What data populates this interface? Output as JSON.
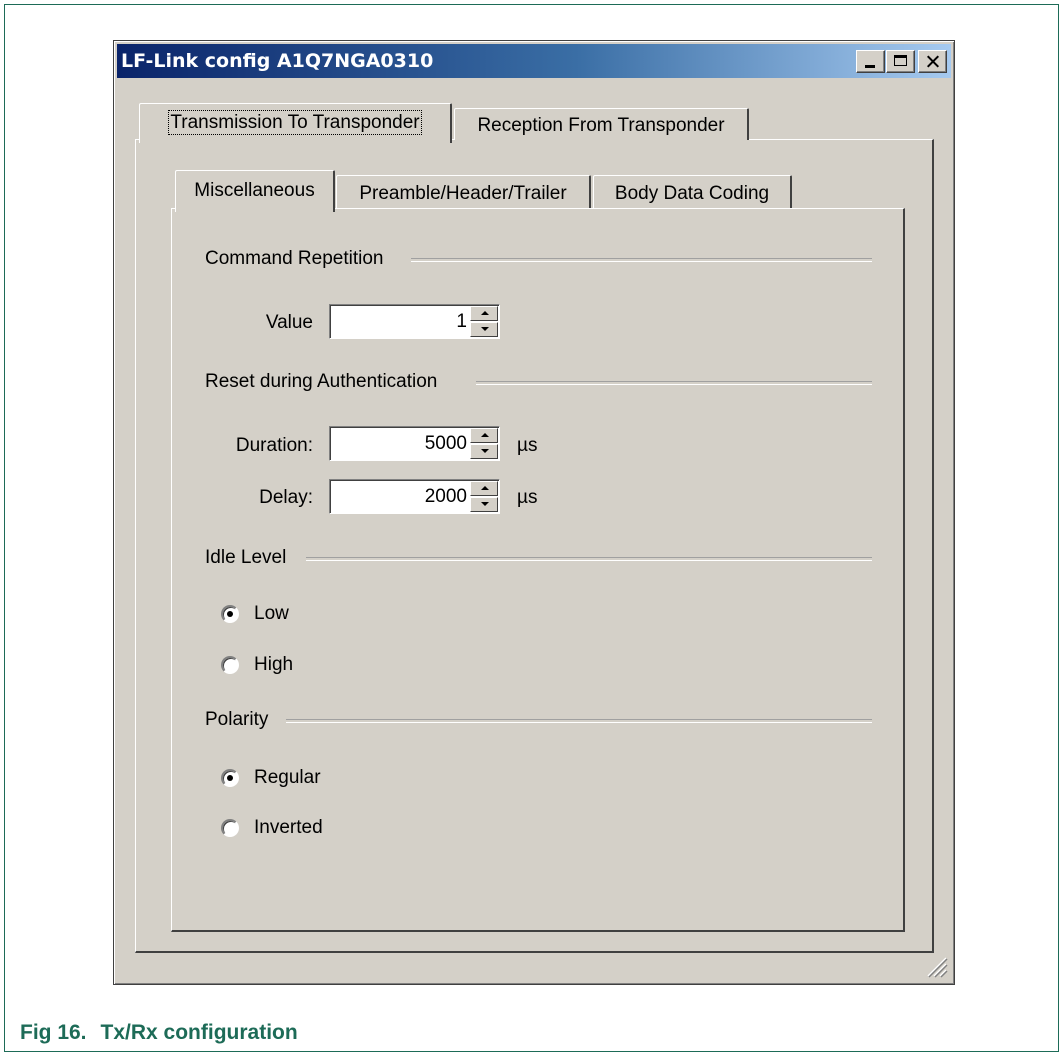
{
  "window": {
    "title": "LF-Link config A1Q7NGA0310"
  },
  "outer_tabs": [
    {
      "label": "Transmission To Transponder",
      "active": true
    },
    {
      "label": "Reception From Transponder",
      "active": false
    }
  ],
  "inner_tabs": [
    {
      "label": "Miscellaneous",
      "active": true
    },
    {
      "label": "Preamble/Header/Trailer",
      "active": false
    },
    {
      "label": "Body Data Coding",
      "active": false
    }
  ],
  "command_repetition": {
    "header": "Command Repetition",
    "value_label": "Value",
    "value": "1"
  },
  "reset_auth": {
    "header": "Reset during Authentication",
    "duration_label": "Duration:",
    "duration_value": "5000",
    "duration_unit": "µs",
    "delay_label": "Delay:",
    "delay_value": "2000",
    "delay_unit": "µs"
  },
  "idle_level": {
    "header": "Idle Level",
    "options": [
      {
        "label": "Low",
        "checked": true
      },
      {
        "label": "High",
        "checked": false
      }
    ]
  },
  "polarity": {
    "header": "Polarity",
    "options": [
      {
        "label": "Regular",
        "checked": true
      },
      {
        "label": "Inverted",
        "checked": false
      }
    ]
  },
  "caption": {
    "number": "Fig 16.",
    "text": "Tx/Rx configuration"
  },
  "colors": {
    "frame_border": "#1d6b57",
    "caption": "#1d6b57",
    "titlebar_start": "#0a246a",
    "titlebar_end": "#a6caf0",
    "dialog_face": "#d4d0c8"
  }
}
